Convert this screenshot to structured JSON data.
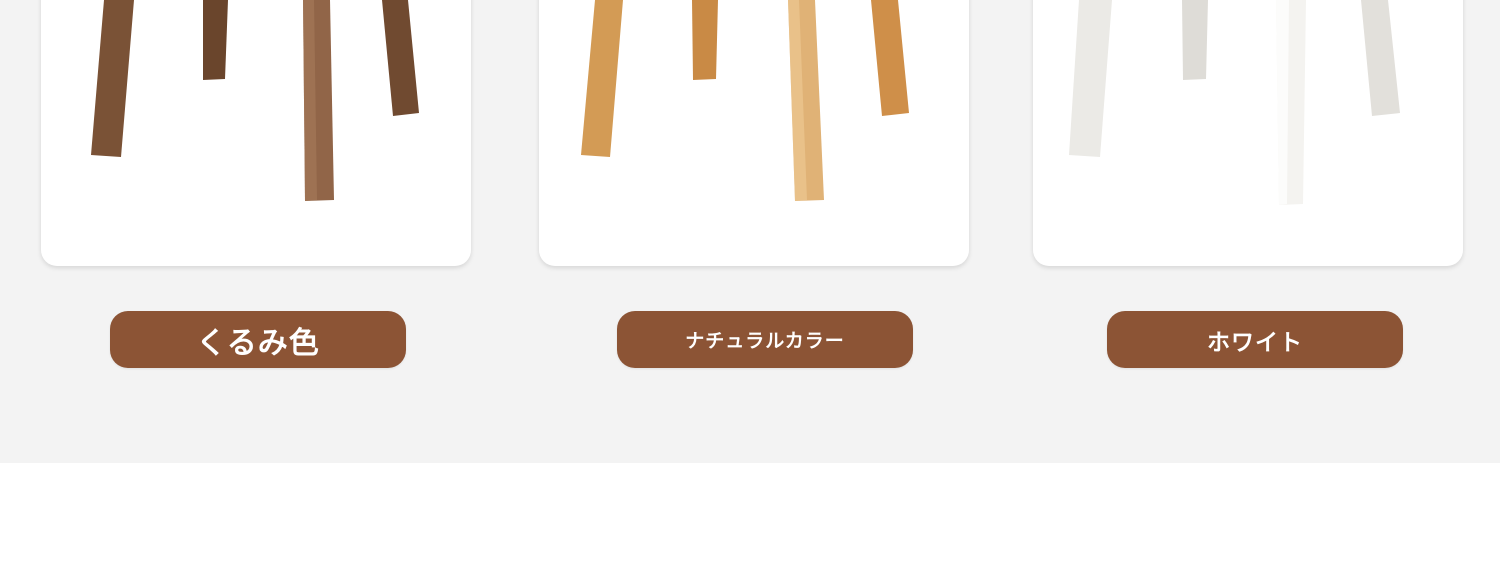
{
  "products": [
    {
      "id": "walnut",
      "label": "くるみ色",
      "leg_color": "#7a5236",
      "leg_highlight": "#9a6f4f"
    },
    {
      "id": "natural",
      "label": "ナチュラルカラー",
      "leg_color": "#d7a15c",
      "leg_highlight": "#ecc488"
    },
    {
      "id": "white",
      "label": "ホワイト",
      "leg_color": "#e9e8e4",
      "leg_highlight": "#ffffff"
    }
  ],
  "colors": {
    "button_bg": "#8c5435",
    "section_bg": "#f3f3f3"
  }
}
